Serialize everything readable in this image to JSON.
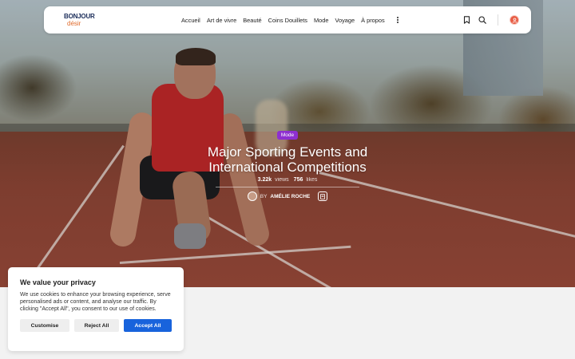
{
  "logo": {
    "line1": "BONJOUR",
    "line2": "désir"
  },
  "nav": {
    "items": [
      {
        "label": "Accueil"
      },
      {
        "label": "Art de vivre"
      },
      {
        "label": "Beauté"
      },
      {
        "label": "Coins Douillets"
      },
      {
        "label": "Mode"
      },
      {
        "label": "Voyage"
      },
      {
        "label": "À propos"
      }
    ],
    "icons": [
      "bookmark-icon",
      "search-icon"
    ],
    "accent": "#e85d45"
  },
  "post": {
    "category": "Mode",
    "category_color": "#8e2fd0",
    "title_line1": "Major Sporting Events and",
    "title_line2": "International Competitions",
    "views_count": "3.22k",
    "views_label": "views",
    "likes_count": "756",
    "likes_label": "likes",
    "author_prefix": "BY",
    "author_name": "AMÉLIE ROCHE"
  },
  "cookie": {
    "title": "We value your privacy",
    "text": "We use cookies to enhance your browsing experience, serve personalised ads or content, and analyse our traffic. By clicking \"Accept All\", you consent to our use of cookies.",
    "customise_label": "Customise",
    "reject_label": "Reject All",
    "accept_label": "Accept All",
    "accept_color": "#1863dc"
  }
}
